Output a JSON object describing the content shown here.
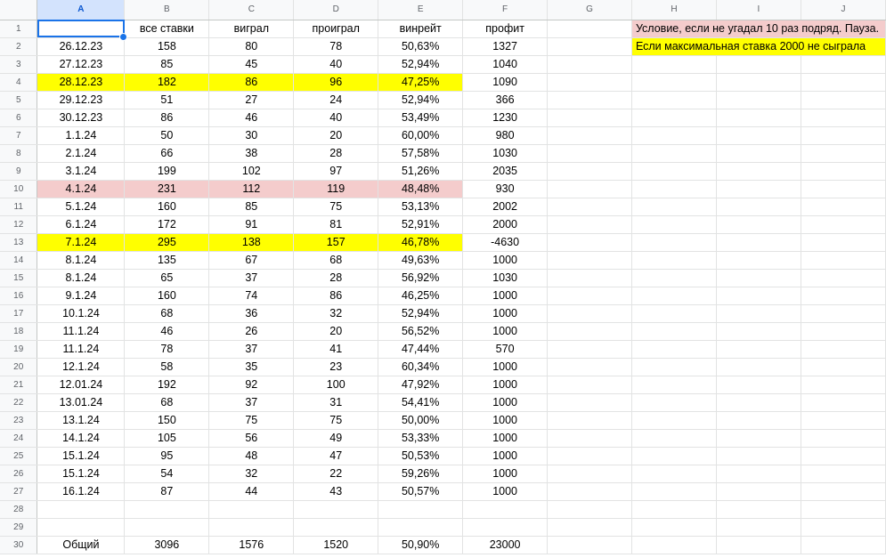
{
  "columns": [
    "A",
    "B",
    "C",
    "D",
    "E",
    "F",
    "G",
    "H",
    "I",
    "J"
  ],
  "selected_column": "A",
  "header_row": {
    "row": "1",
    "b": "все ставки",
    "c": "виграл",
    "d": "проиграл",
    "e": "винрейт",
    "f": "профит"
  },
  "notes": {
    "pink": "Условие, если не угадал 10 раз подряд. Пауза.",
    "yellow": "Если максимальная ставка 2000 не сыграла"
  },
  "highlight_colors": {
    "yellow": "#ffff00",
    "pink": "#f4cccc",
    "selection": "#1a73e8"
  },
  "rows": [
    {
      "row": "2",
      "date": "26.12.23",
      "all": "158",
      "won": "80",
      "lost": "78",
      "winrate": "50,63%",
      "profit": "1327",
      "hl": ""
    },
    {
      "row": "3",
      "date": "27.12.23",
      "all": "85",
      "won": "45",
      "lost": "40",
      "winrate": "52,94%",
      "profit": "1040",
      "hl": ""
    },
    {
      "row": "4",
      "date": "28.12.23",
      "all": "182",
      "won": "86",
      "lost": "96",
      "winrate": "47,25%",
      "profit": "1090",
      "hl": "yellow"
    },
    {
      "row": "5",
      "date": "29.12.23",
      "all": "51",
      "won": "27",
      "lost": "24",
      "winrate": "52,94%",
      "profit": "366",
      "hl": ""
    },
    {
      "row": "6",
      "date": "30.12.23",
      "all": "86",
      "won": "46",
      "lost": "40",
      "winrate": "53,49%",
      "profit": "1230",
      "hl": ""
    },
    {
      "row": "7",
      "date": "1.1.24",
      "all": "50",
      "won": "30",
      "lost": "20",
      "winrate": "60,00%",
      "profit": "980",
      "hl": ""
    },
    {
      "row": "8",
      "date": "2.1.24",
      "all": "66",
      "won": "38",
      "lost": "28",
      "winrate": "57,58%",
      "profit": "1030",
      "hl": ""
    },
    {
      "row": "9",
      "date": "3.1.24",
      "all": "199",
      "won": "102",
      "lost": "97",
      "winrate": "51,26%",
      "profit": "2035",
      "hl": ""
    },
    {
      "row": "10",
      "date": "4.1.24",
      "all": "231",
      "won": "112",
      "lost": "119",
      "winrate": "48,48%",
      "profit": "930",
      "hl": "pink"
    },
    {
      "row": "11",
      "date": "5.1.24",
      "all": "160",
      "won": "85",
      "lost": "75",
      "winrate": "53,13%",
      "profit": "2002",
      "hl": ""
    },
    {
      "row": "12",
      "date": "6.1.24",
      "all": "172",
      "won": "91",
      "lost": "81",
      "winrate": "52,91%",
      "profit": "2000",
      "hl": ""
    },
    {
      "row": "13",
      "date": "7.1.24",
      "all": "295",
      "won": "138",
      "lost": "157",
      "winrate": "46,78%",
      "profit": "-4630",
      "hl": "yellow"
    },
    {
      "row": "14",
      "date": "8.1.24",
      "all": "135",
      "won": "67",
      "lost": "68",
      "winrate": "49,63%",
      "profit": "1000",
      "hl": ""
    },
    {
      "row": "15",
      "date": "8.1.24",
      "all": "65",
      "won": "37",
      "lost": "28",
      "winrate": "56,92%",
      "profit": "1030",
      "hl": ""
    },
    {
      "row": "16",
      "date": "9.1.24",
      "all": "160",
      "won": "74",
      "lost": "86",
      "winrate": "46,25%",
      "profit": "1000",
      "hl": ""
    },
    {
      "row": "17",
      "date": "10.1.24",
      "all": "68",
      "won": "36",
      "lost": "32",
      "winrate": "52,94%",
      "profit": "1000",
      "hl": ""
    },
    {
      "row": "18",
      "date": "11.1.24",
      "all": "46",
      "won": "26",
      "lost": "20",
      "winrate": "56,52%",
      "profit": "1000",
      "hl": ""
    },
    {
      "row": "19",
      "date": "11.1.24",
      "all": "78",
      "won": "37",
      "lost": "41",
      "winrate": "47,44%",
      "profit": "570",
      "hl": ""
    },
    {
      "row": "20",
      "date": "12.1.24",
      "all": "58",
      "won": "35",
      "lost": "23",
      "winrate": "60,34%",
      "profit": "1000",
      "hl": ""
    },
    {
      "row": "21",
      "date": "12.01.24",
      "all": "192",
      "won": "92",
      "lost": "100",
      "winrate": "47,92%",
      "profit": "1000",
      "hl": ""
    },
    {
      "row": "22",
      "date": "13.01.24",
      "all": "68",
      "won": "37",
      "lost": "31",
      "winrate": "54,41%",
      "profit": "1000",
      "hl": ""
    },
    {
      "row": "23",
      "date": "13.1.24",
      "all": "150",
      "won": "75",
      "lost": "75",
      "winrate": "50,00%",
      "profit": "1000",
      "hl": ""
    },
    {
      "row": "24",
      "date": "14.1.24",
      "all": "105",
      "won": "56",
      "lost": "49",
      "winrate": "53,33%",
      "profit": "1000",
      "hl": ""
    },
    {
      "row": "25",
      "date": "15.1.24",
      "all": "95",
      "won": "48",
      "lost": "47",
      "winrate": "50,53%",
      "profit": "1000",
      "hl": ""
    },
    {
      "row": "26",
      "date": "15.1.24",
      "all": "54",
      "won": "32",
      "lost": "22",
      "winrate": "59,26%",
      "profit": "1000",
      "hl": ""
    },
    {
      "row": "27",
      "date": "16.1.24",
      "all": "87",
      "won": "44",
      "lost": "43",
      "winrate": "50,57%",
      "profit": "1000",
      "hl": ""
    },
    {
      "row": "28",
      "date": "",
      "all": "",
      "won": "",
      "lost": "",
      "winrate": "",
      "profit": "",
      "hl": ""
    },
    {
      "row": "29",
      "date": "",
      "all": "",
      "won": "",
      "lost": "",
      "winrate": "",
      "profit": "",
      "hl": ""
    },
    {
      "row": "30",
      "date": "Общий",
      "all": "3096",
      "won": "1576",
      "lost": "1520",
      "winrate": "50,90%",
      "profit": "23000",
      "hl": ""
    }
  ]
}
